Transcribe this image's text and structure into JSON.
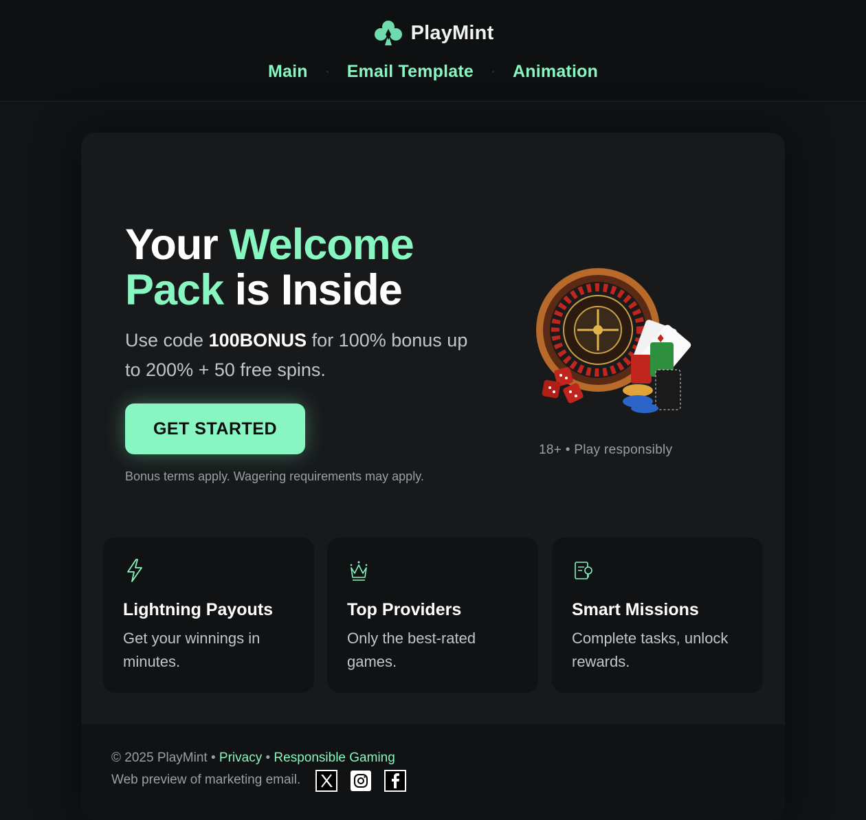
{
  "brand": {
    "name": "PlayMint"
  },
  "nav": {
    "items": [
      "Main",
      "Email Template",
      "Animation"
    ]
  },
  "hero": {
    "title_1": "Your",
    "title_2": "Welcome",
    "title_3": "Pack",
    "title_4": "is Inside",
    "sub_1": "Use code",
    "code": "100BONUS",
    "sub_2": "for 100% bonus up to 200% + 50 free spins.",
    "cta": "GET STARTED",
    "terms": "Bonus terms apply. Wagering requirements may apply.",
    "responsible": "18+ • Play responsibly"
  },
  "features": [
    {
      "icon": "lightning-icon",
      "title": "Lightning Payouts",
      "text": "Get your winnings in minutes."
    },
    {
      "icon": "crown-icon",
      "title": "Top Providers",
      "text": "Only the best-rated games."
    },
    {
      "icon": "missions-icon",
      "title": "Smart Missions",
      "text": "Complete tasks, unlock rewards."
    }
  ],
  "footer": {
    "copyright": "© 2025 PlayMint",
    "sep": "•",
    "privacy": "Privacy",
    "responsible": "Responsible Gaming",
    "preview": "Web preview of marketing email."
  },
  "colors": {
    "accent": "#87f6c0",
    "background": "#111315",
    "card": "#17191b"
  }
}
